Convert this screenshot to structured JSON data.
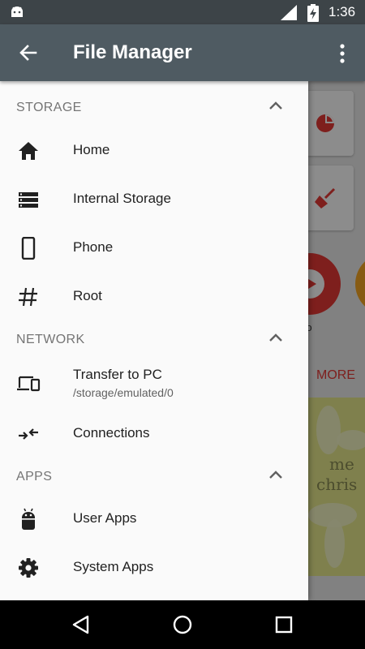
{
  "status_bar": {
    "time": "1:36"
  },
  "app_bar": {
    "title": "File Manager"
  },
  "background": {
    "video_label": "ideo",
    "more_label": "MORE",
    "image_text_1": "me",
    "image_text_2": "chris"
  },
  "drawer": {
    "sections": [
      {
        "label": "STORAGE",
        "items": [
          {
            "label": "Home",
            "icon": "home-icon"
          },
          {
            "label": "Internal Storage",
            "icon": "storage-icon"
          },
          {
            "label": "Phone",
            "icon": "phone-icon"
          },
          {
            "label": "Root",
            "icon": "hash-icon"
          }
        ]
      },
      {
        "label": "NETWORK",
        "items": [
          {
            "label": "Transfer to PC",
            "sub": "/storage/emulated/0",
            "icon": "devices-icon"
          },
          {
            "label": "Connections",
            "icon": "swap-arrows-icon"
          }
        ]
      },
      {
        "label": "APPS",
        "items": [
          {
            "label": "User Apps",
            "icon": "android-icon"
          },
          {
            "label": "System Apps",
            "icon": "gear-icon"
          }
        ]
      }
    ]
  },
  "colors": {
    "appbar": "#4f5b62",
    "statusbar": "#3d4448",
    "accent": "#e53935"
  }
}
